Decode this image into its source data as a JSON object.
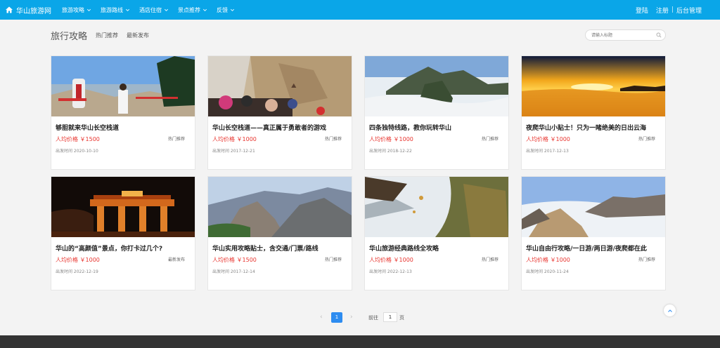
{
  "header": {
    "brand": "华山旅游网",
    "nav": [
      "旅游攻略",
      "旅游路线",
      "酒店住宿",
      "景点推荐",
      "反馈"
    ],
    "login": "登陆",
    "register": "注册",
    "admin": "后台管理",
    "color": "#0aa6e8"
  },
  "section": {
    "title": "旅行攻略",
    "tabs": [
      "热门推荐",
      "最新发布"
    ],
    "search_placeholder": "请输入标题"
  },
  "cards": [
    {
      "title": "够胆就来华山长空栈道",
      "price": "人均价格 ￥1500",
      "category": "热门推荐",
      "date": "出发时间 2020-10-10"
    },
    {
      "title": "华山长空栈道——真正属于勇敢者的游戏",
      "price": "人均价格 ￥1000",
      "category": "热门推荐",
      "date": "出发时间 2017-12-21"
    },
    {
      "title": "四条独特线路，教你玩转华山",
      "price": "人均价格 ￥1000",
      "category": "热门推荐",
      "date": "出发时间 2018-12-22"
    },
    {
      "title": "夜爬华山小贴士！只为一睹绝美的日出云海",
      "price": "人均价格 ￥1000",
      "category": "热门推荐",
      "date": "出发时间 2017-12-13"
    },
    {
      "title": "华山的“高颜值”景点，你打卡过几个?",
      "price": "人均价格 ￥1000",
      "category": "最新发布",
      "date": "出发时间 2022-12-19"
    },
    {
      "title": "华山实用攻略贴士，含交通/门票/路线",
      "price": "人均价格 ￥1500",
      "category": "热门推荐",
      "date": "出发时间 2017-12-14"
    },
    {
      "title": "华山旅游经典路线全攻略",
      "price": "人均价格 ￥1000",
      "category": "热门推荐",
      "date": "出发时间 2022-12-13"
    },
    {
      "title": "华山自由行攻略/一日游/两日游/夜爬都在此",
      "price": "人均价格 ￥1000",
      "category": "热门推荐",
      "date": "出发时间 2020-11-24"
    }
  ],
  "pagination": {
    "current": "1",
    "goto_label": "前往",
    "goto_value": "1",
    "goto_suffix": "页"
  }
}
